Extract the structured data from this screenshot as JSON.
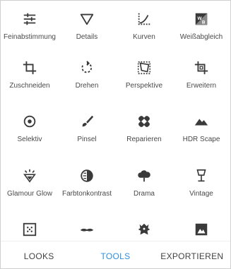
{
  "tools": [
    {
      "label": "Feinabstimmung",
      "icon": "tune-sliders-icon"
    },
    {
      "label": "Details",
      "icon": "triangle-details-icon"
    },
    {
      "label": "Kurven",
      "icon": "curves-icon"
    },
    {
      "label": "Weißabgleich",
      "icon": "white-balance-icon"
    },
    {
      "label": "Zuschneiden",
      "icon": "crop-icon"
    },
    {
      "label": "Drehen",
      "icon": "rotate-icon"
    },
    {
      "label": "Perspektive",
      "icon": "perspective-icon"
    },
    {
      "label": "Erweitern",
      "icon": "expand-icon"
    },
    {
      "label": "Selektiv",
      "icon": "selective-target-icon"
    },
    {
      "label": "Pinsel",
      "icon": "brush-icon"
    },
    {
      "label": "Reparieren",
      "icon": "healing-bandage-icon"
    },
    {
      "label": "HDR Scape",
      "icon": "mountain-hdr-icon"
    },
    {
      "label": "Glamour Glow",
      "icon": "glamour-glow-icon"
    },
    {
      "label": "Farbtonkontrast",
      "icon": "tonal-contrast-icon"
    },
    {
      "label": "Drama",
      "icon": "drama-cloud-icon"
    },
    {
      "label": "Vintage",
      "icon": "vintage-lamp-icon"
    },
    {
      "label": "",
      "icon": "grainy-film-icon"
    },
    {
      "label": "",
      "icon": "retrolux-mustache-icon"
    },
    {
      "label": "",
      "icon": "grunge-icon"
    },
    {
      "label": "",
      "icon": "black-white-icon"
    }
  ],
  "tabs": {
    "looks": "LOOKS",
    "tools": "TOOLS",
    "export": "EXPORTIEREN"
  },
  "colors": {
    "accent": "#2f8fde",
    "icon": "#3a3a3a",
    "text": "#4a4a4a"
  }
}
